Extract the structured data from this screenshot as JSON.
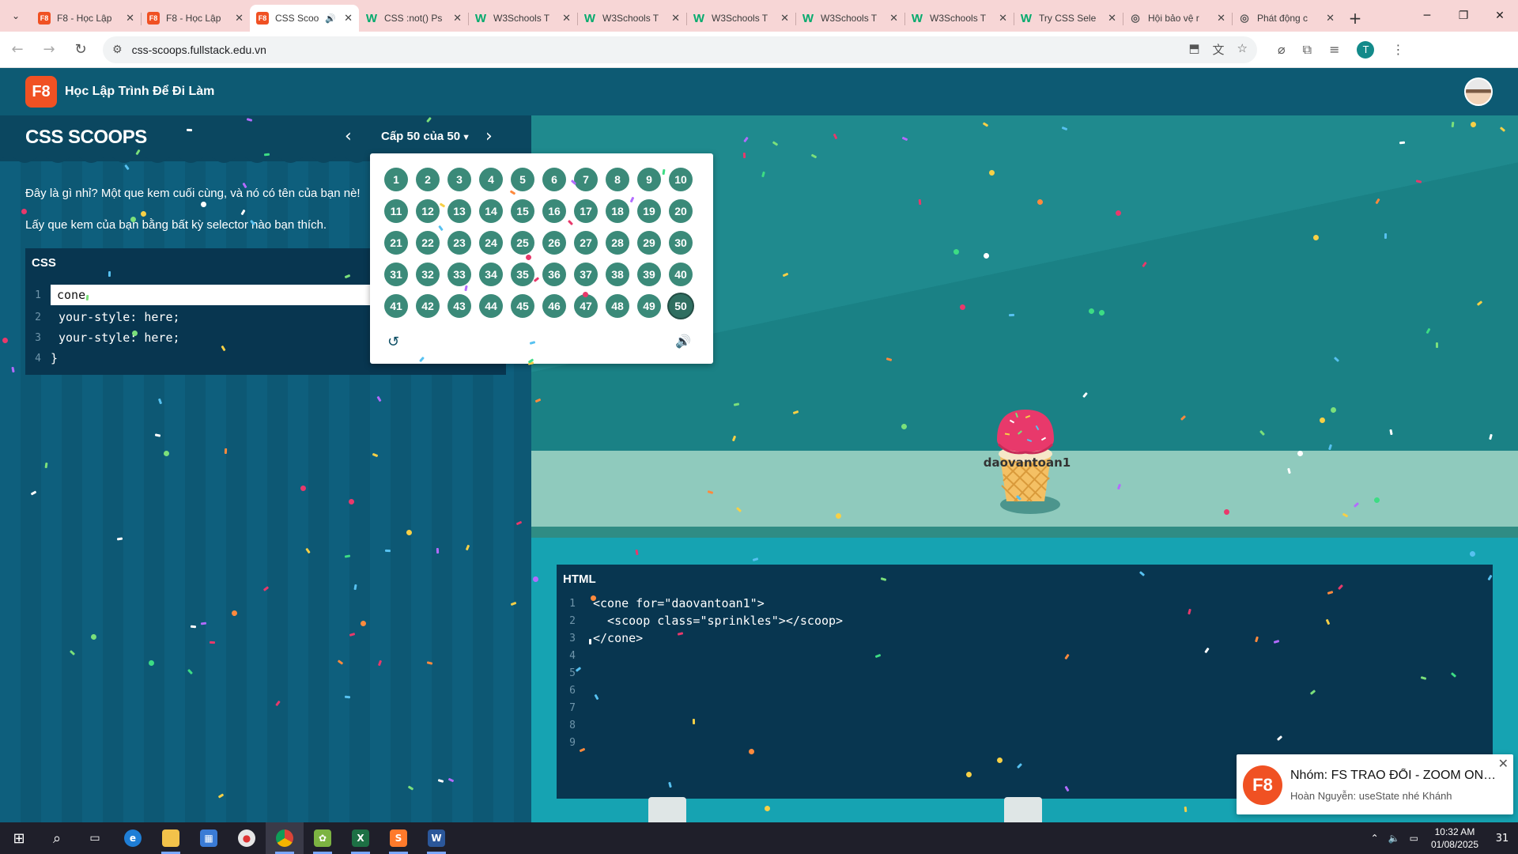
{
  "browser": {
    "tabs": [
      {
        "title": "F8 - Học Lập",
        "favicon": "f8",
        "active": false
      },
      {
        "title": "F8 - Học Lập",
        "favicon": "f8",
        "active": false
      },
      {
        "title": "CSS Scoo",
        "favicon": "f8",
        "active": true,
        "audio": true
      },
      {
        "title": "CSS :not() Ps",
        "favicon": "w3",
        "active": false
      },
      {
        "title": "W3Schools T",
        "favicon": "w3",
        "active": false
      },
      {
        "title": "W3Schools T",
        "favicon": "w3",
        "active": false
      },
      {
        "title": "W3Schools T",
        "favicon": "w3",
        "active": false
      },
      {
        "title": "W3Schools T",
        "favicon": "w3",
        "active": false
      },
      {
        "title": "W3Schools T",
        "favicon": "w3",
        "active": false
      },
      {
        "title": "Try CSS Sele",
        "favicon": "w3",
        "active": false
      },
      {
        "title": "Hội bảo vệ r",
        "favicon": "globe",
        "active": false
      },
      {
        "title": "Phát động c",
        "favicon": "globe",
        "active": false
      }
    ],
    "url": "css-scoops.fullstack.edu.vn",
    "profile_initial": "T"
  },
  "site": {
    "logo": "F8",
    "title": "Học Lập Trình Để Đi Làm"
  },
  "game": {
    "title": "CSS SCOOPS",
    "level_indicator": "Cấp 50 của 50",
    "instruction_1": "Đây là gì nhỉ? Một que kem cuối cùng, và nó có tên của bạn nè!",
    "instruction_2": "Lấy que kem của bạn bằng bất kỳ selector nào bạn thích.",
    "current_level": 50,
    "total_levels": 50,
    "css_editor": {
      "title": "CSS",
      "input_value": "cone",
      "line_numbers": [
        "1",
        "2",
        "3",
        "4"
      ],
      "lines": [
        "your-style: here;",
        "your-style: here;",
        "}"
      ]
    },
    "html_viewer": {
      "title": "HTML",
      "line_numbers": [
        "1",
        "2",
        "3",
        "4",
        "5",
        "6",
        "7",
        "8",
        "9"
      ],
      "lines": [
        "<cone for=\"daovantoan1\">",
        "  <scoop class=\"sprinkles\"></scoop>",
        "</cone>",
        "",
        "",
        "",
        "",
        "",
        ""
      ]
    },
    "cone_label": "daovantoan1"
  },
  "toast": {
    "logo": "F8",
    "title": "Nhóm: FS TRAO ĐỔI - ZOOM ONLINE",
    "body": "Hoàn Nguyễn: useState nhé Khánh"
  },
  "taskbar": {
    "time": "10:32 AM",
    "date": "01/08/2025",
    "notification_count": "31",
    "apps": [
      "windows-start",
      "search",
      "task-view",
      "edge",
      "file-explorer",
      "microsoft-store",
      "browser-badge",
      "chrome",
      "game-app",
      "excel",
      "sublime",
      "word"
    ]
  },
  "colors": {
    "f8_orange": "#f05123",
    "level_button": "#3b8a79",
    "editor_bg": "#083650"
  }
}
